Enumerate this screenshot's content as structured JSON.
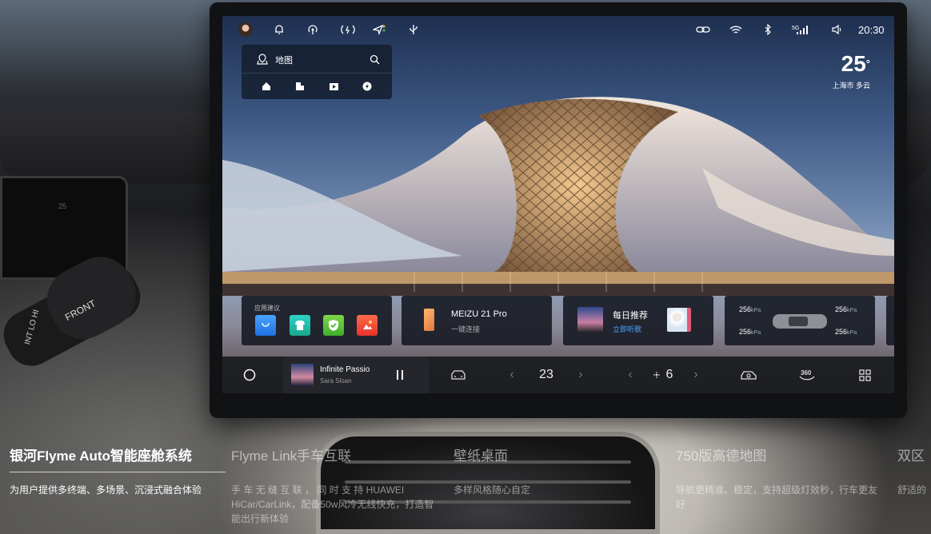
{
  "status_bar": {
    "time": "20:30",
    "left_icons": [
      "avatar",
      "bell-icon",
      "hotspot-icon",
      "signal-broadcast-icon",
      "navigation-icon",
      "usb-icon"
    ],
    "right_icons": [
      "link-icon",
      "wifi-icon",
      "bluetooth-icon",
      "5g-signal-icon",
      "volume-icon"
    ],
    "network_label": "5G"
  },
  "map_widget": {
    "title": "地图",
    "shortcuts": [
      "home-icon",
      "company-icon",
      "media-icon",
      "charging-icon"
    ]
  },
  "weather": {
    "temperature": "25",
    "degree_symbol": "°",
    "location": "上海市 多云"
  },
  "cards": {
    "app_suggestions": {
      "label": "应用建议",
      "apps": [
        "app-store-icon",
        "theme-icon",
        "security-icon",
        "gallery-icon"
      ]
    },
    "phone": {
      "title": "MEIZU 21 Pro",
      "subtitle": "一键连接"
    },
    "daily": {
      "title": "每日推荐",
      "subtitle": "立即听歌",
      "subtitle_color": "#4aa3ff"
    },
    "tire_pressure": {
      "front_left": "256",
      "front_right": "256",
      "rear_left": "256",
      "rear_right": "256",
      "unit": "kPa"
    }
  },
  "dock": {
    "song_title": "Infinite Passio",
    "artist": "Sara Sloan",
    "temperature": "23",
    "fan_level": "6",
    "camera_label": "360"
  },
  "footer": [
    {
      "title": "银河Flyme Auto智能座舱系统",
      "body": "为用户提供多终端、多场景、沉浸式融合体验"
    },
    {
      "title": "Flyme Link手车互联",
      "body": "手 车 无 缝 互 联 ， 同 时 支 持 HUAWEI HiCar/CarLink，配备50w风冷无线快充，打造智能出行新体验"
    },
    {
      "title": "壁纸桌面",
      "body": "多样风格随心自定"
    },
    {
      "title": "750版高德地图",
      "body": "导航更精准、稳定，支持超级灯效秒，行车更友好"
    },
    {
      "title": "双区",
      "body": "舒适的"
    }
  ],
  "colors": {
    "accent_blue": "#4aa3ff",
    "dock_bg": "#1c1e22",
    "card_bg": "#161a22"
  }
}
